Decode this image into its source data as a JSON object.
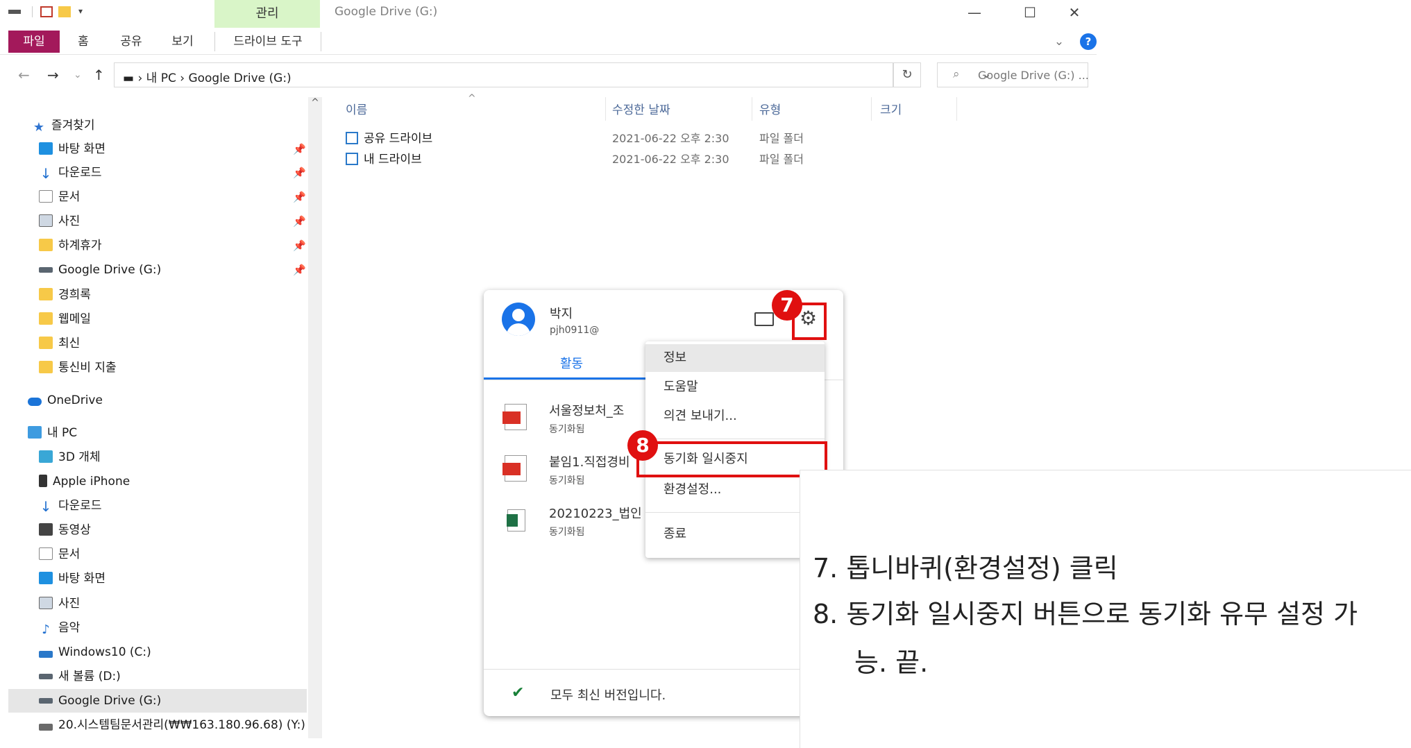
{
  "window": {
    "title": "Google Drive (G:)",
    "manage_tab": "관리",
    "controls": {
      "minimize": "—",
      "maximize": "☐",
      "close": "✕"
    }
  },
  "ribbon": {
    "tabs": [
      "파일",
      "홈",
      "공유",
      "보기",
      "드라이브 도구"
    ],
    "collapse": "⌄",
    "help": "?"
  },
  "address": {
    "back": "←",
    "forward": "→",
    "recent": "⌄",
    "up": "↑",
    "path": "▬ › 내 PC › Google Drive (G:)",
    "dropdown": "⌄",
    "refresh": "↻",
    "search_placeholder": "Google Drive (G:) ..."
  },
  "sidebar": {
    "scroll_up": "^",
    "items": [
      {
        "label": "즐겨찾기",
        "icon": "star-icon"
      },
      {
        "label": "바탕 화면",
        "icon": "desktop-icon",
        "pin": "📌"
      },
      {
        "label": "다운로드",
        "icon": "download-icon",
        "pin": "📌"
      },
      {
        "label": "문서",
        "icon": "document-icon",
        "pin": "📌"
      },
      {
        "label": "사진",
        "icon": "pictures-icon",
        "pin": "📌"
      },
      {
        "label": "하계휴가",
        "icon": "folder-icon",
        "pin": "📌"
      },
      {
        "label": "Google Drive (G:)",
        "icon": "drive-icon",
        "pin": "📌"
      },
      {
        "label": "경희록",
        "icon": "folder-icon"
      },
      {
        "label": "웹메일",
        "icon": "folder-icon"
      },
      {
        "label": "최신",
        "icon": "folder-icon"
      },
      {
        "label": "통신비 지출",
        "icon": "folder-icon"
      },
      {
        "label": "OneDrive",
        "icon": "cloud-icon"
      },
      {
        "label": "내 PC",
        "icon": "pc-icon"
      },
      {
        "label": "3D 개체",
        "icon": "3d-objects-icon"
      },
      {
        "label": "Apple iPhone",
        "icon": "phone-icon"
      },
      {
        "label": "다운로드",
        "icon": "download-icon"
      },
      {
        "label": "동영상",
        "icon": "video-icon"
      },
      {
        "label": "문서",
        "icon": "document-icon"
      },
      {
        "label": "바탕 화면",
        "icon": "desktop-icon"
      },
      {
        "label": "사진",
        "icon": "pictures-icon"
      },
      {
        "label": "음악",
        "icon": "music-icon"
      },
      {
        "label": "Windows10 (C:)",
        "icon": "windows-drive-icon"
      },
      {
        "label": "새 볼륨 (D:)",
        "icon": "drive-icon"
      },
      {
        "label": "Google Drive (G:)",
        "icon": "drive-icon",
        "selected": true
      },
      {
        "label": "20.시스템팀문서관리(₩₩163.180.96.68) (Y:)",
        "icon": "network-drive-icon"
      }
    ]
  },
  "file_list": {
    "columns": [
      "이름",
      "수정한 날짜",
      "유형",
      "크기"
    ],
    "sort_arrow": "^",
    "rows": [
      {
        "name": "공유 드라이브",
        "date": "2021-06-22 오후 2:30",
        "type": "파일 폴더"
      },
      {
        "name": "내 드라이브",
        "date": "2021-06-22 오후 2:30",
        "type": "파일 폴더"
      }
    ]
  },
  "drive_popup": {
    "user_name": "박지",
    "user_email": "pjh0911@",
    "tab_activity": "활동",
    "activity": [
      {
        "title": "서울정보처_조",
        "status": "동기화됨",
        "icon": "pdf-icon"
      },
      {
        "title": "붙임1.직접경비",
        "status": "동기화됨",
        "icon": "pdf-icon"
      },
      {
        "title": "20210223_법인",
        "status": "동기화됨",
        "icon": "excel-icon"
      }
    ],
    "footer": "모두 최신 버전입니다."
  },
  "menu": {
    "items": [
      "정보",
      "도움말",
      "의견 보내기...",
      "동기화 일시중지",
      "환경설정...",
      "종료"
    ]
  },
  "callouts": {
    "badge7": "7",
    "badge8": "8",
    "color": "#e01010"
  },
  "note": {
    "line1": "7.  톱니바퀴(환경설정) 클릭",
    "line2": "8.  동기화 일시중지 버튼으로 동기화 유무 설정 가",
    "line3": "능. 끝."
  },
  "colors": {
    "file_tab": "#a3195b",
    "manage_tab": "#d9f5c8",
    "accent": "#1a73e8",
    "selected_bg": "#e6e6e6"
  }
}
